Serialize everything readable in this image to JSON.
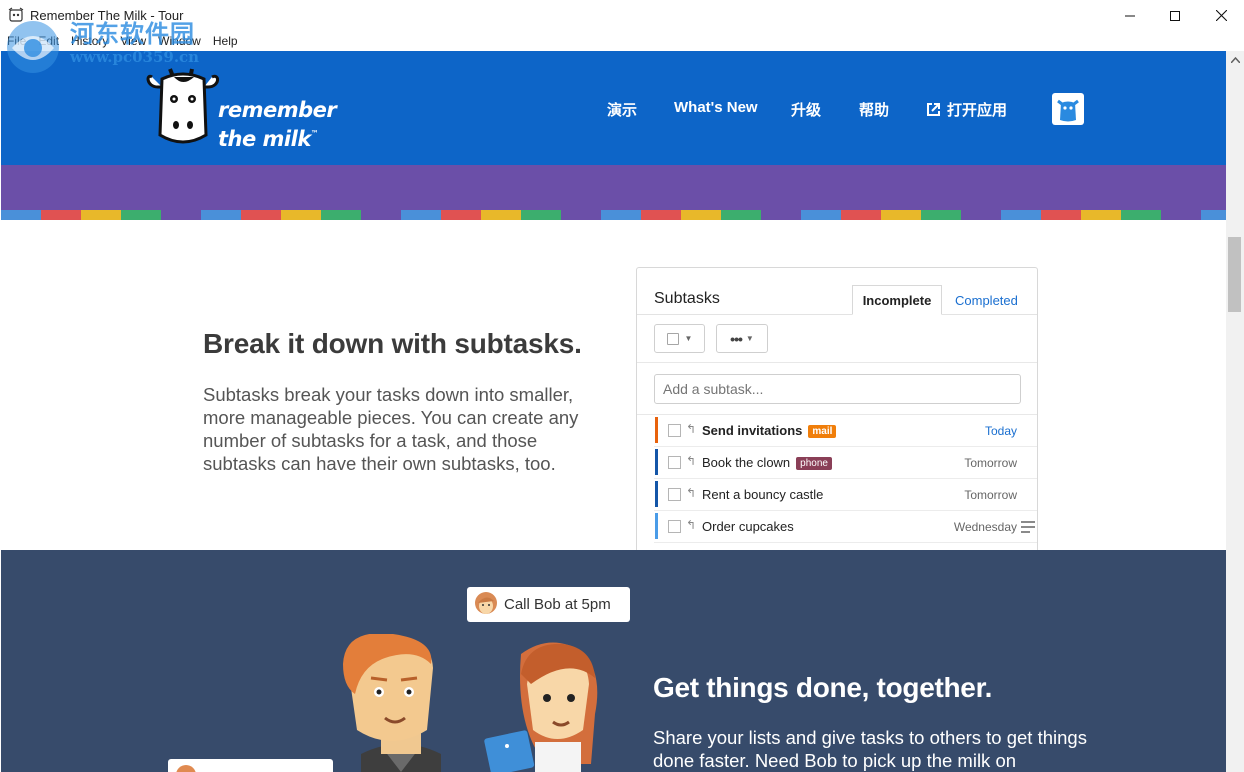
{
  "window": {
    "title": "Remember The Milk - Tour",
    "controls": {
      "minimize": "─",
      "maximize": "☐",
      "close": "✕"
    }
  },
  "menubar": [
    "File",
    "Edit",
    "History",
    "View",
    "Window",
    "Help"
  ],
  "watermark": {
    "name": "河东软件园",
    "url": "www.pc0359.cn"
  },
  "header": {
    "logo_text": [
      "remember",
      "the milk"
    ],
    "logo_tm": "™",
    "nav": {
      "demo": "演示",
      "whats_new": "What's New",
      "upgrade": "升级",
      "help": "帮助",
      "open_app": "打开应用"
    },
    "colors": {
      "header_bg": "#0d65c8",
      "purple": "#6b4fa8"
    }
  },
  "stripe_colors": [
    "#4a90d9",
    "#e05252",
    "#e8b82a",
    "#3cae6e",
    "#6b4fa8"
  ],
  "feature_subtasks": {
    "heading": "Break it down with subtasks.",
    "body": "Subtasks break your tasks down into smaller, more manageable pieces. You can create any number of subtasks for a task, and those subtasks can have their own subtasks, too."
  },
  "subtasks_card": {
    "title": "Subtasks",
    "tabs": {
      "incomplete": "Incomplete",
      "completed": "Completed"
    },
    "more_glyph": "•••",
    "add_placeholder": "Add a subtask...",
    "tasks": [
      {
        "name": "Send invitations",
        "tag": "mail",
        "tag_color": "#f07e0a",
        "due": "Today",
        "bar_color": "#e8620c",
        "bold": true
      },
      {
        "name": "Book the clown",
        "tag": "phone",
        "tag_color": "#8a3f57",
        "due": "Tomorrow",
        "bar_color": "#1456a8",
        "bold": false
      },
      {
        "name": "Rent a bouncy castle",
        "tag": "",
        "tag_color": "",
        "due": "Tomorrow",
        "bar_color": "#1456a8",
        "bold": false
      },
      {
        "name": "Order cupcakes",
        "tag": "",
        "tag_color": "",
        "due": "Wednesday",
        "bar_color": "#4a9ce8",
        "bold": false,
        "has_notes": true
      }
    ]
  },
  "feature_together": {
    "bubble": "Call Bob at 5pm",
    "heading": "Get things done, together.",
    "body": "Share your lists and give tasks to others to get things done faster. Need Bob to pick up the milk on"
  }
}
